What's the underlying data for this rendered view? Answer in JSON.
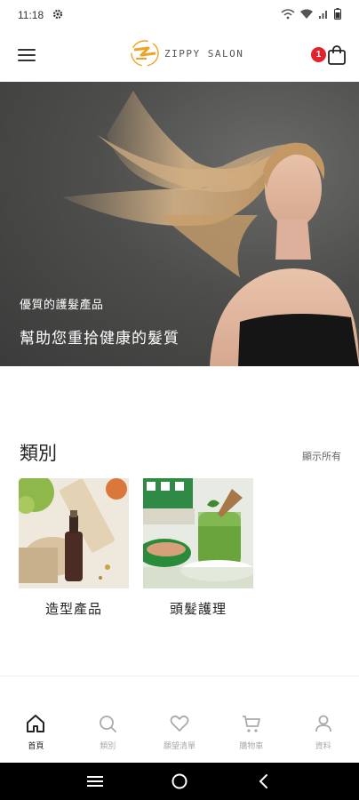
{
  "status_bar": {
    "time": "11:18",
    "icons": [
      "gear-icon",
      "wifi-calling-icon",
      "wifi-icon",
      "signal-icon",
      "battery-icon"
    ]
  },
  "header": {
    "brand": "ZIPPY SALON",
    "cart_count": "1"
  },
  "hero": {
    "subtitle": "優質的護髮產品",
    "title": "幫助您重拾健康的髮質"
  },
  "categories": {
    "title": "類別",
    "show_all": "顯示所有",
    "items": [
      {
        "label": "造型產品",
        "icon": "styling-products-image"
      },
      {
        "label": "頭髮護理",
        "icon": "hair-care-image"
      }
    ]
  },
  "bottom_nav": {
    "items": [
      {
        "label": "首頁",
        "icon": "home-icon",
        "active": true
      },
      {
        "label": "類別",
        "icon": "search-icon",
        "active": false
      },
      {
        "label": "願望清單",
        "icon": "heart-icon",
        "active": false
      },
      {
        "label": "購物車",
        "icon": "cart-icon",
        "active": false
      },
      {
        "label": "資料",
        "icon": "profile-icon",
        "active": false
      }
    ]
  },
  "colors": {
    "accent": "#e1232a",
    "logo_orange": "#f0a226",
    "text": "#222222",
    "muted": "#aaaaaa"
  }
}
